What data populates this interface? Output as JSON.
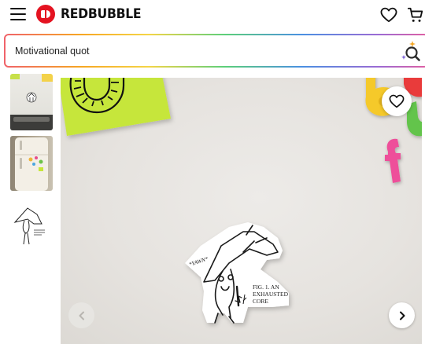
{
  "header": {
    "brand": "REDBUBBLE",
    "icons": {
      "menu": "hamburger-menu-icon",
      "logo": "redbubble-logo-icon",
      "wishlist": "heart-icon",
      "cart": "cart-icon"
    }
  },
  "search": {
    "value": "Motivational quot",
    "icon": "sparkle-search-icon"
  },
  "product_images": {
    "thumbnails": [
      {
        "name": "thumbnail-sticker-on-appliance"
      },
      {
        "name": "thumbnail-sticker-on-fridge"
      },
      {
        "name": "thumbnail-sticker-design"
      }
    ],
    "main": {
      "sticker_text": "FIG. 1. AN EXHAUSTED CORE",
      "sticker_speech": "*YAWN*"
    }
  },
  "controls": {
    "wishlist_icon": "heart-icon",
    "prev_icon": "chevron-left-icon",
    "next_icon": "chevron-right-icon"
  },
  "colors": {
    "brand_red": "#e41321",
    "sticky_note": "#c6e63a"
  }
}
